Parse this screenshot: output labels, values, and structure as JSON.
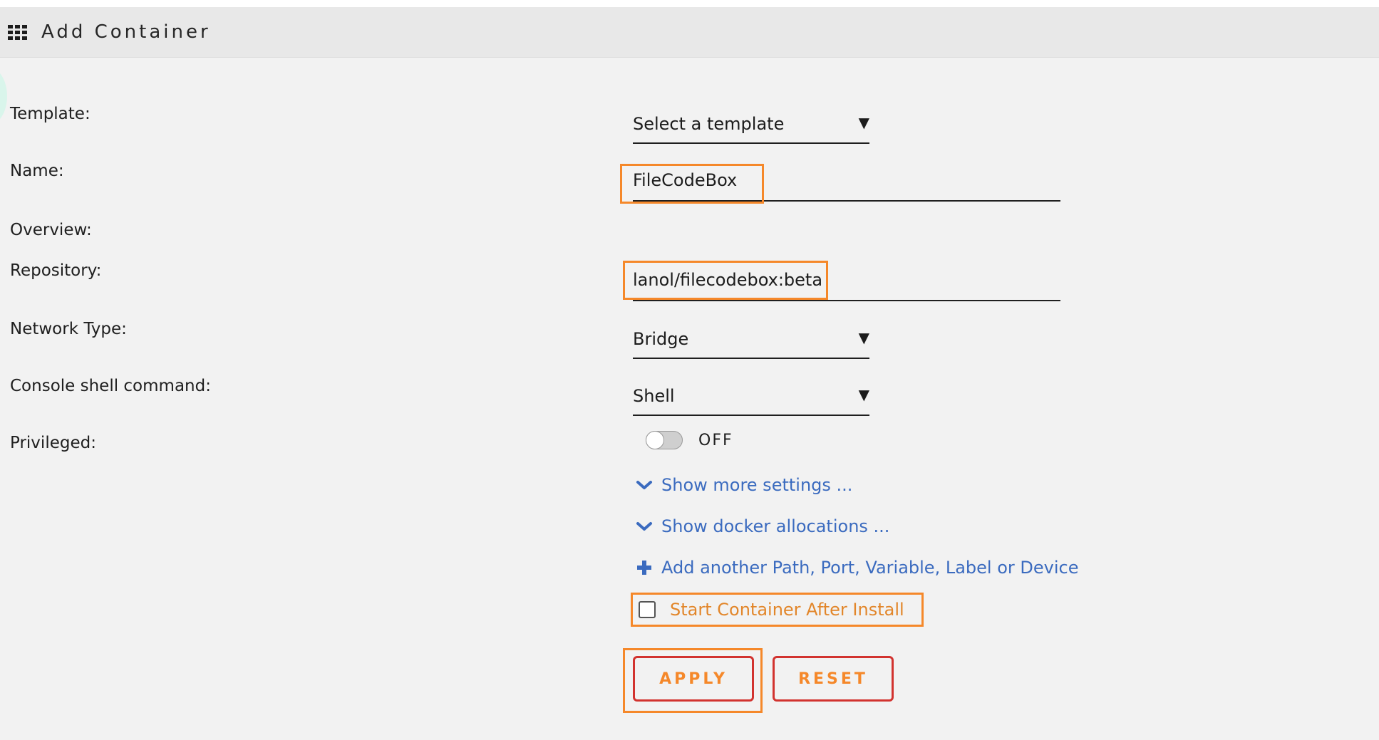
{
  "header": {
    "title": "Add Container",
    "icon": "grid-icon"
  },
  "form": {
    "template": {
      "label": "Template:",
      "value": "Select a template"
    },
    "name": {
      "label": "Name:",
      "value": "FileCodeBox"
    },
    "overview": {
      "label": "Overview:"
    },
    "repository": {
      "label": "Repository:",
      "value": "lanol/filecodebox:beta"
    },
    "network_type": {
      "label": "Network Type:",
      "value": "Bridge"
    },
    "console_shell": {
      "label": "Console shell command:",
      "value": "Shell"
    },
    "privileged": {
      "label": "Privileged:",
      "state": "OFF"
    }
  },
  "links": {
    "more_settings": "Show more settings ...",
    "docker_allocations": "Show docker allocations ...",
    "add_another": "Add another Path, Port, Variable, Label or Device"
  },
  "start_after_install": {
    "label": "Start Container After Install",
    "checked": false
  },
  "buttons": {
    "apply": "APPLY",
    "reset": "RESET"
  },
  "colors": {
    "link": "#3b6bbf",
    "highlight": "#f5882a",
    "button_border": "#d2332f",
    "button_text": "#f5882a"
  }
}
